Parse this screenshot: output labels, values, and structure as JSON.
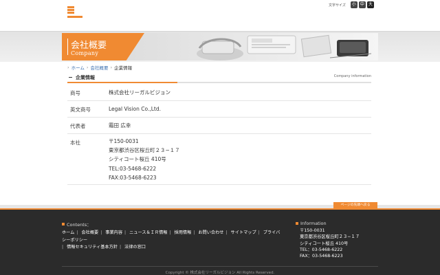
{
  "header": {
    "fontsize_label": "文字サイズ",
    "fontsize_small": "小",
    "fontsize_medium": "中",
    "fontsize_large": "大"
  },
  "banner": {
    "title_jp": "会社概要",
    "title_en": "Company"
  },
  "breadcrumb": {
    "items": [
      "ホーム",
      "会社概要",
      "企業情報"
    ],
    "separator": "›"
  },
  "section": {
    "title": "企業情報",
    "title_en": "Company information"
  },
  "info": {
    "rows": [
      {
        "label": "商号",
        "value": "株式会社リーガルビジョン"
      },
      {
        "label": "英文商号",
        "value": "Legal Vision Co.,Ltd."
      },
      {
        "label": "代表者",
        "value": "霜田 広幸"
      },
      {
        "label": "本社",
        "lines": [
          "〒150-0031",
          "東京都渋谷区桜丘町２３−１７",
          "シティコート桜丘 410号",
          "TEL:03-5468-6222",
          "FAX:03-5468-6223"
        ]
      }
    ]
  },
  "pagetop": {
    "label": "ページの先頭へ戻る"
  },
  "footer": {
    "contents_heading": "Contents：",
    "links": [
      "ホーム",
      "会社概要",
      "事業内容",
      "ニュース＆ＩＲ情報",
      "採用情報",
      "お問い合わせ",
      "サイトマップ",
      "プライバシーポリシー",
      "情報セキュリティ基本方針",
      "法律の窓口"
    ],
    "info_heading": "Information",
    "info_lines": [
      "〒150-0031",
      "東京都渋谷区桜丘町２３−１７",
      "シティコート桜丘 410号",
      "TEL：03-5468-6222",
      "FAX：03-5468-6223"
    ],
    "copyright": "Copyright © 株式会社リーガルビジョン All Rights Reserved."
  },
  "colors": {
    "accent": "#f08a32",
    "footer_bg": "#2b2b2b",
    "link": "#3a6fb0"
  }
}
